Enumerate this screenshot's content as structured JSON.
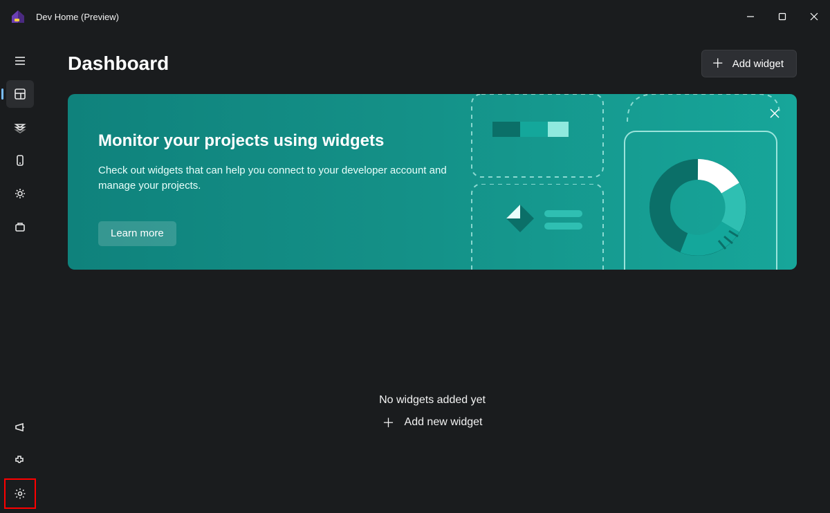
{
  "window": {
    "title": "Dev Home (Preview)"
  },
  "sidebar": {
    "items": [
      {
        "name": "dashboard"
      },
      {
        "name": "machine-configuration"
      },
      {
        "name": "dev-drive"
      },
      {
        "name": "utilities"
      },
      {
        "name": "apps"
      }
    ],
    "footer": [
      {
        "name": "feedback"
      },
      {
        "name": "extensions"
      },
      {
        "name": "settings"
      }
    ]
  },
  "header": {
    "title": "Dashboard",
    "add_widget_label": "Add widget"
  },
  "banner": {
    "title": "Monitor your projects using widgets",
    "description": "Check out widgets that can help you connect to your developer account and manage your projects.",
    "learn_more_label": "Learn more"
  },
  "empty": {
    "title": "No widgets added yet",
    "add_label": "Add new widget"
  },
  "colors": {
    "accent": "#79bdff",
    "banner_from": "#0f827c",
    "banner_to": "#17a69a",
    "highlight": "#ff0000"
  }
}
